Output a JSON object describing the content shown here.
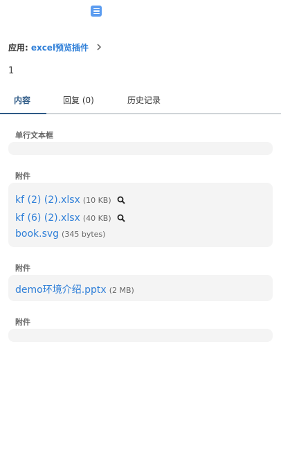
{
  "header": {
    "app_label": "应用:",
    "app_name": "excel预览插件",
    "count": "1"
  },
  "tabs": [
    {
      "label": "内容",
      "active": true
    },
    {
      "label": "回复 (0)",
      "active": false
    },
    {
      "label": "历史记录",
      "active": false
    }
  ],
  "fields": {
    "single_line": {
      "label": "单行文本框",
      "value": ""
    },
    "attachment1": {
      "label": "附件",
      "files": [
        {
          "name": "kf (2) (2).xlsx",
          "size": "(10 KB)",
          "previewable": true
        },
        {
          "name": "kf (6) (2).xlsx",
          "size": "(40 KB)",
          "previewable": true
        },
        {
          "name": "book.svg",
          "size": "(345 bytes)",
          "previewable": false
        }
      ]
    },
    "attachment2": {
      "label": "附件",
      "files": [
        {
          "name": "demo环境介绍.pptx",
          "size": "(2 MB)",
          "previewable": false
        }
      ]
    },
    "attachment3": {
      "label": "附件",
      "files": []
    }
  },
  "icons": {
    "top": "list-icon",
    "chevron": "chevron-right-icon",
    "preview": "search-icon"
  },
  "colors": {
    "accent": "#2f7fd8",
    "tab_active": "#2e5a86",
    "field_bg": "#f4f4f4",
    "top_icon_bg": "#5b9cf0"
  }
}
